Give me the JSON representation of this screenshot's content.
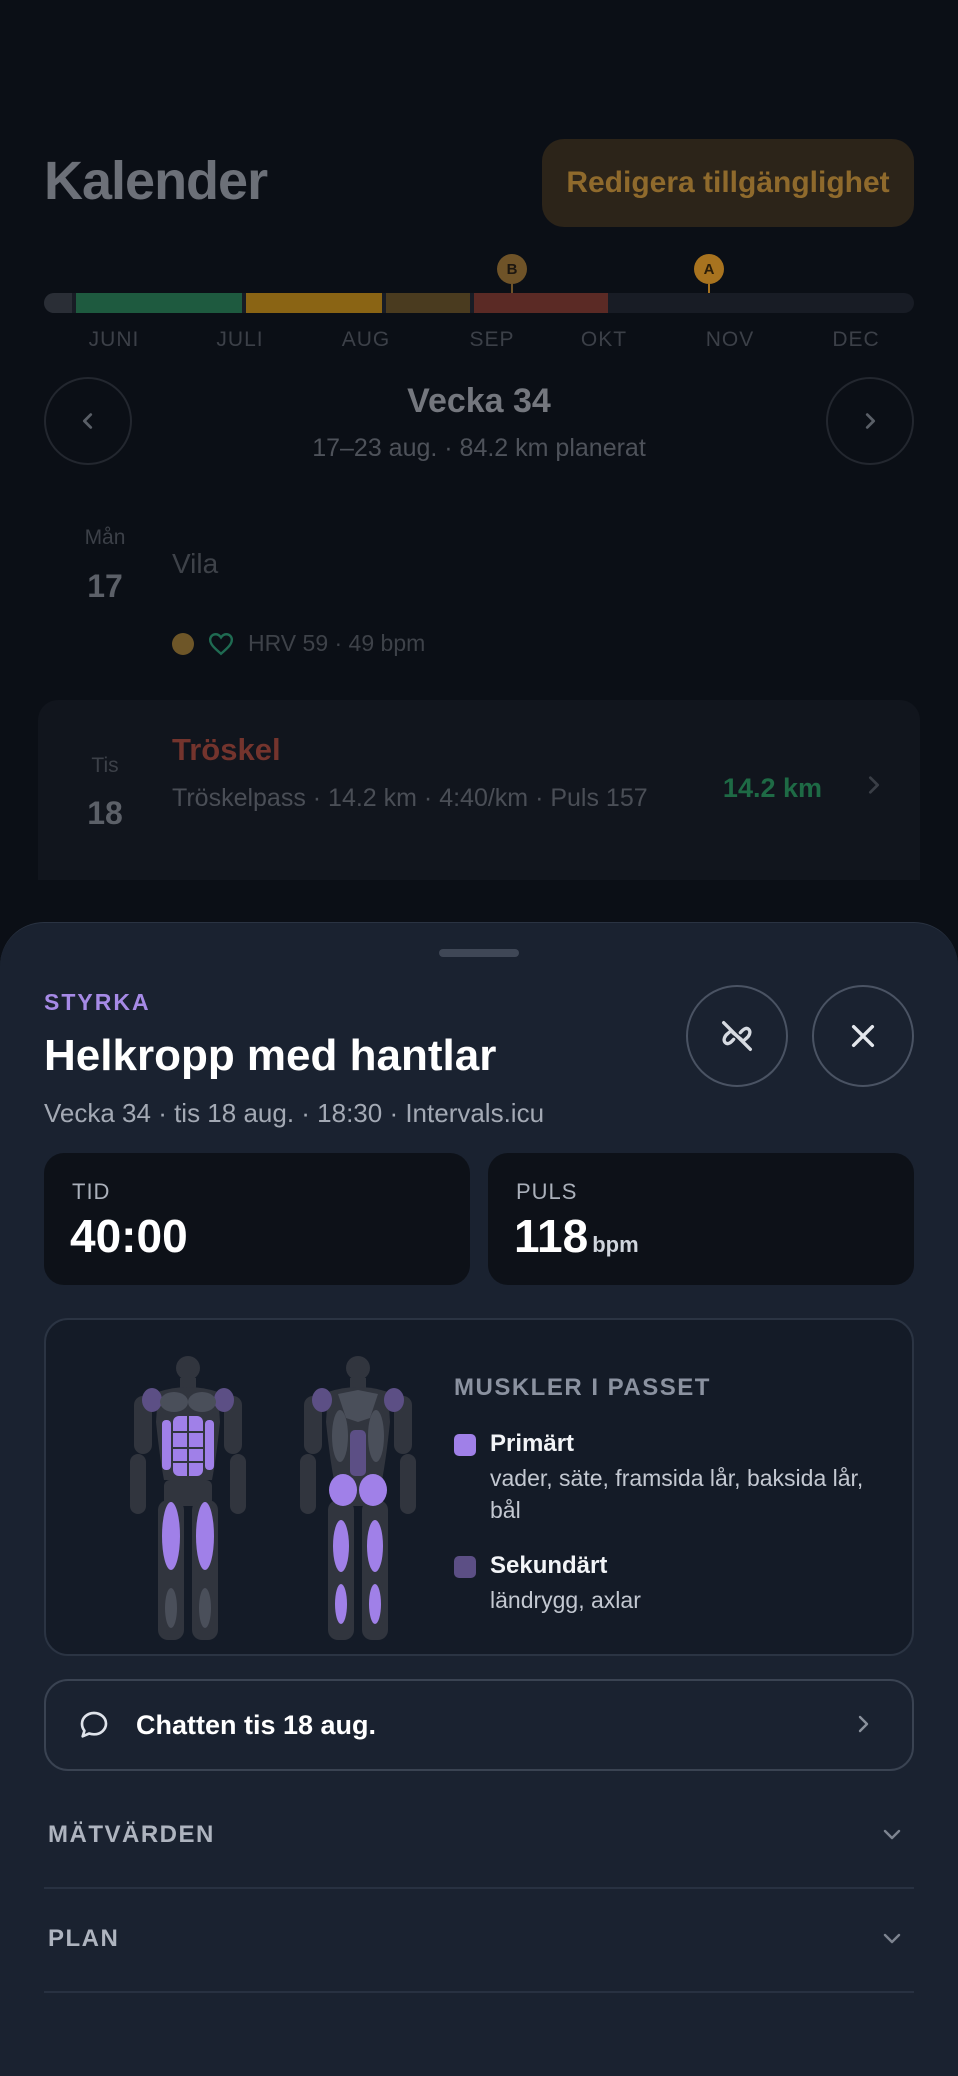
{
  "header": {
    "title": "Kalender",
    "availability_button": "Redigera tillgänglighet"
  },
  "timeline": {
    "months": [
      "JUNI",
      "JULI",
      "AUG",
      "SEP",
      "OKT",
      "NOV",
      "DEC"
    ],
    "markers": [
      {
        "label": "B",
        "color": "#6f5328"
      },
      {
        "label": "A",
        "color": "#a8731f"
      }
    ],
    "phase_colors": [
      "#1e5a3f",
      "#8a6414",
      "#4a3b1f",
      "#5b2a25"
    ]
  },
  "week": {
    "title": "Vecka 34",
    "subtitle": "17–23 aug. · 84.2 km planerat",
    "prev_icon": "chevron-left-icon",
    "next_icon": "chevron-right-icon"
  },
  "days": [
    {
      "weekday": "Mån",
      "date": "17",
      "label": "Vila",
      "hrv": "HRV 59 · 49 bpm"
    },
    {
      "weekday": "Tis",
      "date": "18",
      "workout_title": "Tröskel",
      "workout_desc": "Tröskelpass · 14.2 km · 4:40/km · Puls 157",
      "distance": "14.2 km"
    }
  ],
  "sheet": {
    "category": "STYRKA",
    "title": "Helkropp med hantlar",
    "meta": "Vecka 34 · tis 18 aug. · 18:30 · Intervals.icu",
    "unlink_icon": "unlink-icon",
    "close_icon": "close-icon",
    "stats": {
      "time_label": "TID",
      "time_value": "40:00",
      "hr_label": "PULS",
      "hr_value": "118",
      "hr_unit": "bpm"
    },
    "muscles": {
      "heading": "MUSKLER I PASSET",
      "primary_title": "Primärt",
      "primary_text": "vader, säte, framsida lår, baksida lår, bål",
      "secondary_title": "Sekundärt",
      "secondary_text": "ländrygg, axlar",
      "primary_color": "#a080e8",
      "secondary_color": "#5c4f85"
    },
    "chat": {
      "label": "Chatten tis 18 aug.",
      "icon": "chat-bubble-icon"
    },
    "sections": [
      {
        "label": "MÄTVÄRDEN"
      },
      {
        "label": "PLAN"
      }
    ]
  }
}
